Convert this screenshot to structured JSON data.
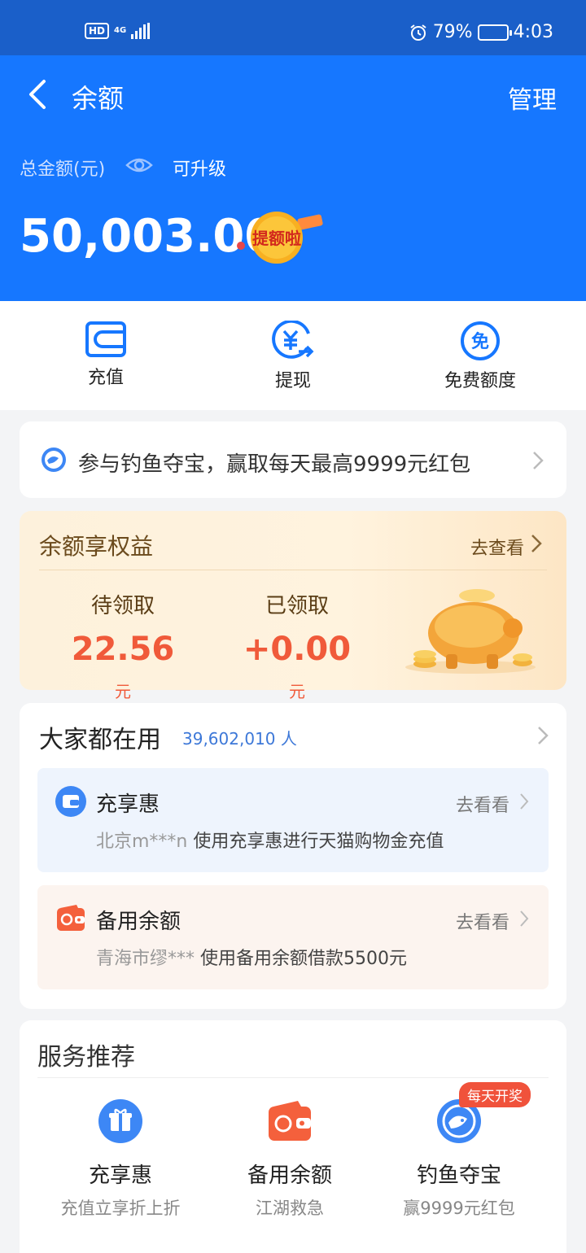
{
  "status_bar": {
    "hd": "HD",
    "network": "4G",
    "battery_percent": "79%",
    "battery_level": 0.79,
    "time": "4:03"
  },
  "header": {
    "title": "余额",
    "manage": "管理",
    "total_label": "总金额(元)",
    "upgrade": "可升级",
    "amount": "50,003.00",
    "badge": "提额啦"
  },
  "actions": [
    {
      "label": "充值",
      "icon": "wallet-icon"
    },
    {
      "label": "提现",
      "icon": "yuan-withdraw-icon"
    },
    {
      "label": "免费额度",
      "icon": "free-icon",
      "icon_text": "免"
    }
  ],
  "promo": {
    "text": "参与钓鱼夺宝，赢取每天最高9999元红包",
    "icon": "fish-icon"
  },
  "benefits": {
    "title": "余额享权益",
    "more": "去查看",
    "pending_label": "待领取",
    "pending_value": "22.56",
    "received_label": "已领取",
    "received_value": "+0.00",
    "unit": "元",
    "image": "piggy-bank-illustration"
  },
  "popular": {
    "title": "大家都在用",
    "count": "39,602,010 人",
    "items": [
      {
        "name": "充享惠",
        "more": "去看看",
        "user": "北京m***n",
        "desc": "使用充享惠进行天猫购物金充值",
        "icon": "card-icon",
        "bg": "#eef4fd"
      },
      {
        "name": "备用余额",
        "more": "去看看",
        "user": "青海市缪***",
        "desc": "使用备用余额借款5500元",
        "icon": "wallet-red-icon",
        "bg": "#fcf4ef"
      }
    ]
  },
  "services": {
    "title": "服务推荐",
    "tag": "每天开奖",
    "items": [
      {
        "name": "充享惠",
        "desc": "充值立享折上折",
        "icon": "gift-icon"
      },
      {
        "name": "备用余额",
        "desc": "江湖救急",
        "icon": "wallet-red-icon"
      },
      {
        "name": "钓鱼夺宝",
        "desc": "赢9999元红包",
        "icon": "fish-icon"
      }
    ]
  },
  "colors": {
    "primary": "#1677ff",
    "status_bar": "#1a5fc9",
    "accent_red": "#f05a3a",
    "link_blue": "#3d78d8"
  }
}
